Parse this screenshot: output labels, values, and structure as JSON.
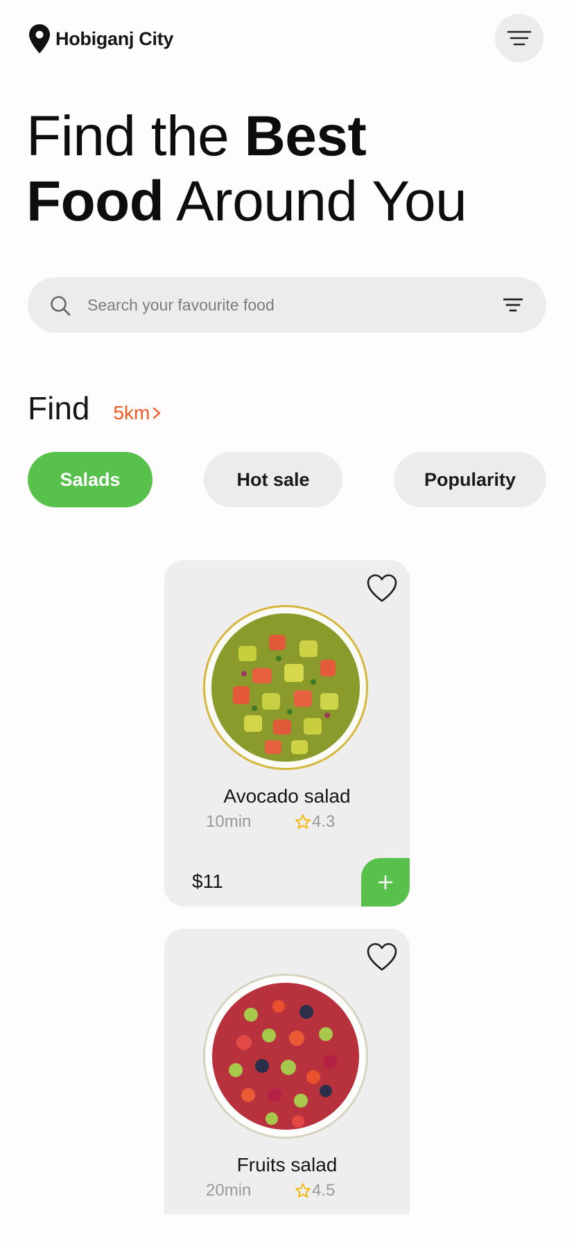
{
  "header": {
    "location": "Hobiganj City",
    "location_icon": "location-pin-icon",
    "menu_icon": "menu-icon"
  },
  "hero": {
    "part1": "Find the ",
    "part2_bold": "Best",
    "part3_bold": "Food",
    "part4": " Around You"
  },
  "search": {
    "placeholder": "Search your favourite food",
    "value": "",
    "search_icon": "search-icon",
    "filter_icon": "filter-icon"
  },
  "find": {
    "title": "Find",
    "distance": "5km",
    "distance_icon": "chevron-right-icon"
  },
  "categories": [
    {
      "label": "Salads",
      "active": true
    },
    {
      "label": "Hot sale",
      "active": false
    },
    {
      "label": "Popularity",
      "active": false
    }
  ],
  "foods": [
    {
      "name": "Avocado salad",
      "time": "10min",
      "rating": "4.3",
      "price": "$11",
      "favorite": false
    },
    {
      "name": "Fruits salad",
      "time": "20min",
      "rating": "4.5",
      "favorite": false
    }
  ],
  "colors": {
    "accent": "#58c14b",
    "distance": "#f05a22",
    "chip_bg": "#ececec",
    "card_bg": "#eeeeee",
    "star": "#f5b400"
  }
}
